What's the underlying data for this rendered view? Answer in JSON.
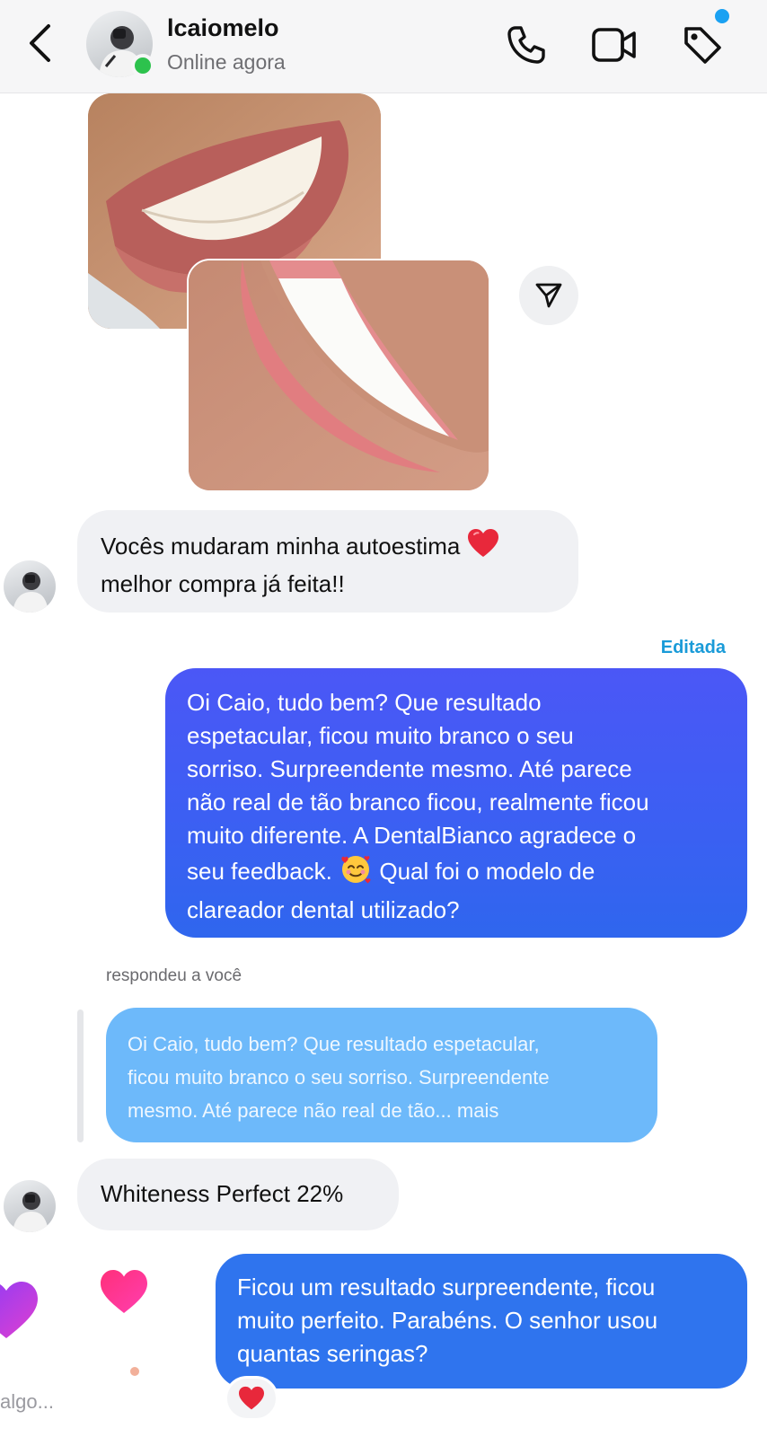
{
  "header": {
    "username": "lcaiomelo",
    "status": "Online agora"
  },
  "colors": {
    "online": "#2dc24d",
    "edited_label": "#1a9bd8",
    "outgoing_bubble_top": "#4b57f6",
    "outgoing_bubble_bottom": "#2f66ee",
    "outgoing_bubble_last": "#2f74ee",
    "quoted_bubble": "#6db9fa",
    "heart": "#e8283b"
  },
  "icons": {
    "back": "chevron-left-icon",
    "call": "phone-icon",
    "video": "video-camera-icon",
    "tag": "tag-icon",
    "share": "paper-plane-icon"
  },
  "messages": {
    "incoming_1": {
      "line1": "Vocês mudaram minha autoestima",
      "line2": "melhor compra já feita!!"
    },
    "edited_label": "Editada",
    "outgoing_1": {
      "lines": [
        "Oi Caio, tudo bem? Que resultado",
        "espetacular, ficou muito branco o seu",
        "sorriso. Surpreendente mesmo. Até parece",
        "não real de tão branco ficou, realmente ficou",
        "muito diferente. A DentalBianco agradece o",
        "seu feedback.",
        "Qual foi o modelo de",
        "clareador dental utilizado?"
      ]
    },
    "reply_label": "respondeu a você",
    "quoted": {
      "lines": [
        "Oi Caio, tudo bem? Que resultado espetacular,",
        "ficou muito branco o seu sorriso. Surpreendente",
        "mesmo. Até parece não real de tão... mais"
      ]
    },
    "incoming_2": "Whiteness Perfect 22%",
    "outgoing_2": {
      "lines": [
        "Ficou um resultado surpreendente, ficou",
        "muito perfeito. Parabéns. O senhor usou",
        "quantas seringas?"
      ]
    }
  },
  "composer_hint": "algo..."
}
